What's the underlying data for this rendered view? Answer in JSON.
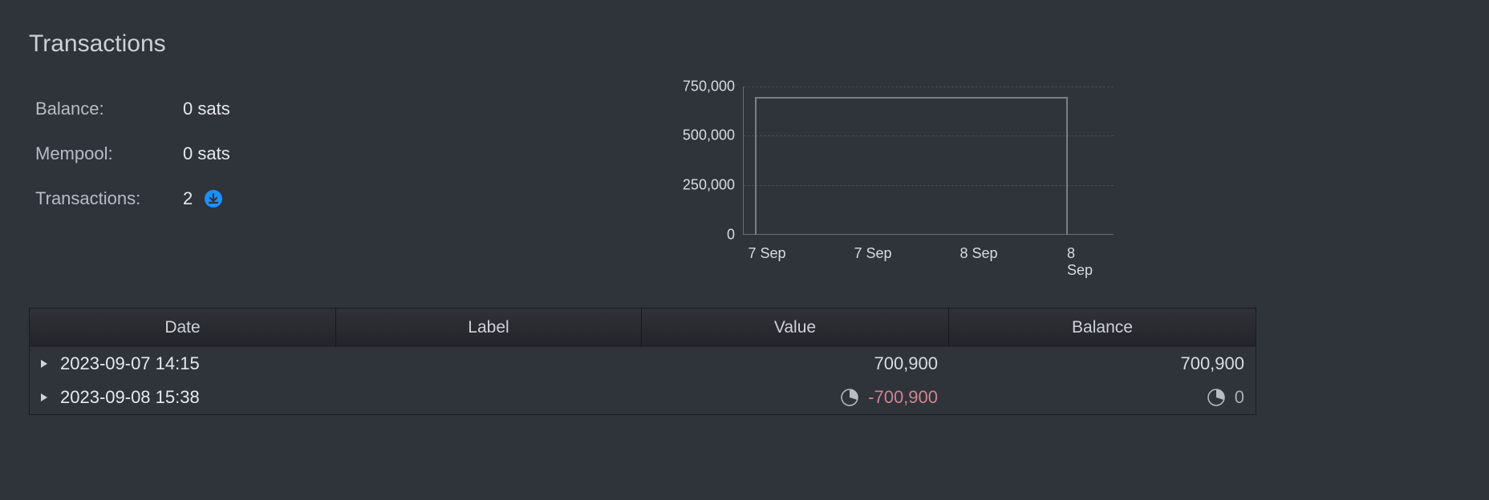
{
  "title": "Transactions",
  "stats": {
    "balance_label": "Balance:",
    "balance_value": "0 sats",
    "mempool_label": "Mempool:",
    "mempool_value": "0 sats",
    "transactions_label": "Transactions:",
    "transactions_value": "2"
  },
  "chart_data": {
    "type": "line",
    "title": "",
    "xlabel": "",
    "ylabel": "",
    "ylim": [
      0,
      750000
    ],
    "yticks": [
      0,
      250000,
      500000,
      750000
    ],
    "ytick_labels": [
      "0",
      "250,000",
      "500,000",
      "750,000"
    ],
    "xtick_labels": [
      "7 Sep",
      "7 Sep",
      "8 Sep",
      "8 Sep"
    ],
    "x": [
      "2023-09-07 00:00",
      "2023-09-07 14:15",
      "2023-09-08 15:38",
      "2023-09-08 24:00"
    ],
    "values": [
      0,
      700900,
      700900,
      0
    ]
  },
  "table": {
    "headers": {
      "date": "Date",
      "label": "Label",
      "value": "Value",
      "balance": "Balance"
    },
    "rows": [
      {
        "date": "2023-09-07 14:15",
        "label": "",
        "value": "700,900",
        "value_negative": false,
        "show_pie": false,
        "balance": "700,900",
        "dim": false
      },
      {
        "date": "2023-09-08 15:38",
        "label": "",
        "value": "-700,900",
        "value_negative": true,
        "show_pie": true,
        "balance": "0",
        "dim": true
      }
    ]
  }
}
